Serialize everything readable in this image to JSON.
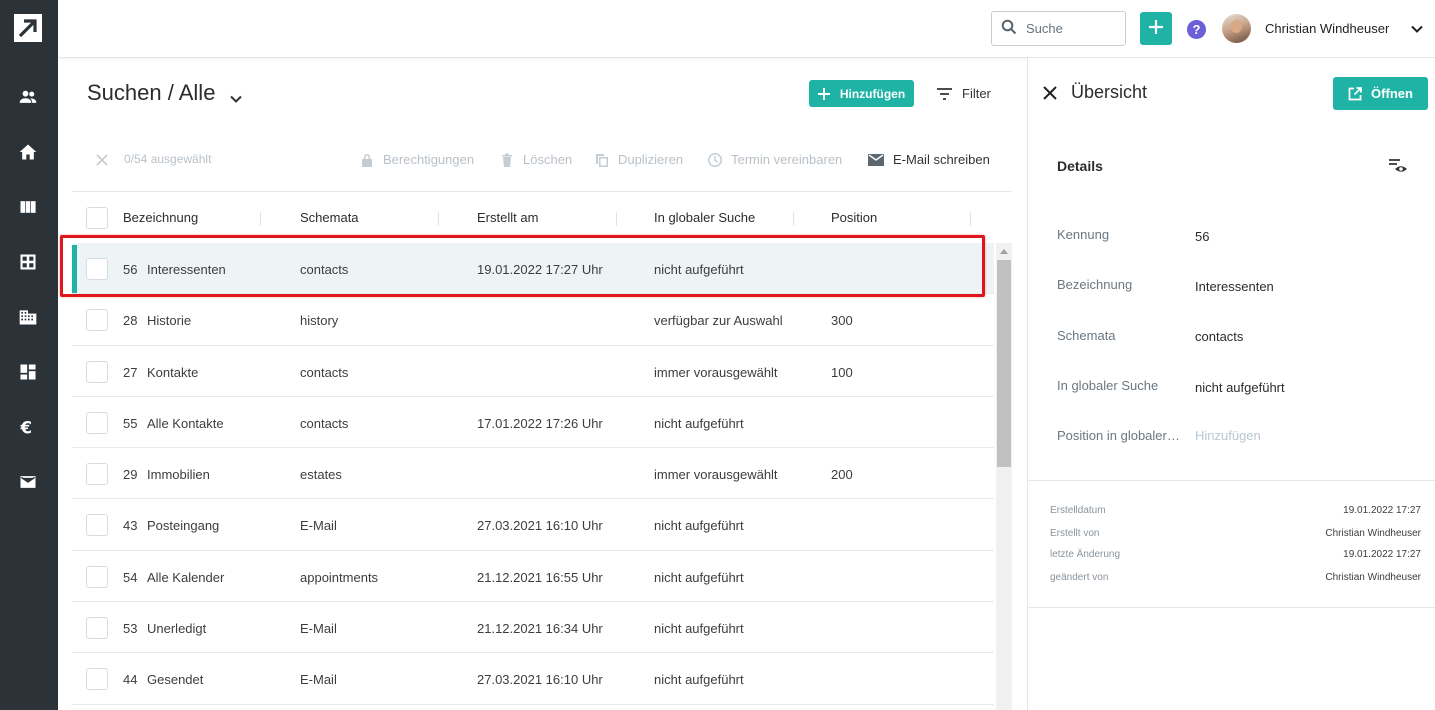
{
  "topbar": {
    "search_placeholder": "Suche",
    "help_label": "?",
    "user_name": "Christian Windheuser"
  },
  "sidebar": {
    "items": [
      "contacts-icon",
      "home-icon",
      "book-icon",
      "grid-icon",
      "building-icon",
      "dashboard-icon",
      "euro-icon",
      "mail-icon"
    ]
  },
  "main": {
    "title": "Suchen / Alle",
    "add_label": "Hinzufügen",
    "filter_label": "Filter",
    "selection_count": "0/54 ausgewählt",
    "actions": {
      "permissions": "Berechtigungen",
      "delete": "Löschen",
      "duplicate": "Duplizieren",
      "appointment": "Termin vereinbaren",
      "email": "E-Mail schreiben"
    },
    "columns": [
      "Bezeichnung",
      "Schemata",
      "Erstellt am",
      "In globaler Suche",
      "Position"
    ],
    "rows": [
      {
        "id": "56",
        "name": "Interessenten",
        "schema": "contacts",
        "created": "19.01.2022 17:27 Uhr",
        "global": "nicht aufgeführt",
        "position": ""
      },
      {
        "id": "28",
        "name": "Historie",
        "schema": "history",
        "created": "",
        "global": "verfügbar zur Auswahl",
        "position": "300"
      },
      {
        "id": "27",
        "name": "Kontakte",
        "schema": "contacts",
        "created": "",
        "global": "immer vorausgewählt",
        "position": "100"
      },
      {
        "id": "55",
        "name": "Alle Kontakte",
        "schema": "contacts",
        "created": "17.01.2022 17:26 Uhr",
        "global": "nicht aufgeführt",
        "position": ""
      },
      {
        "id": "29",
        "name": "Immobilien",
        "schema": "estates",
        "created": "",
        "global": "immer vorausgewählt",
        "position": "200"
      },
      {
        "id": "43",
        "name": "Posteingang",
        "schema": "E-Mail",
        "created": "27.03.2021 16:10 Uhr",
        "global": "nicht aufgeführt",
        "position": ""
      },
      {
        "id": "54",
        "name": "Alle Kalender",
        "schema": "appointments",
        "created": "21.12.2021 16:55 Uhr",
        "global": "nicht aufgeführt",
        "position": ""
      },
      {
        "id": "53",
        "name": "Unerledigt",
        "schema": "E-Mail",
        "created": "21.12.2021 16:34 Uhr",
        "global": "nicht aufgeführt",
        "position": ""
      },
      {
        "id": "44",
        "name": "Gesendet",
        "schema": "E-Mail",
        "created": "27.03.2021 16:10 Uhr",
        "global": "nicht aufgeführt",
        "position": ""
      }
    ]
  },
  "panel": {
    "title": "Übersicht",
    "open_label": "Öffnen",
    "details_title": "Details",
    "fields": [
      {
        "label": "Kennung",
        "value": "56"
      },
      {
        "label": "Bezeichnung",
        "value": "Interessenten"
      },
      {
        "label": "Schemata",
        "value": "contacts"
      },
      {
        "label": "In globaler Suche",
        "value": "nicht aufgeführt"
      },
      {
        "label": "Position in globaler…",
        "value": "Hinzufügen"
      }
    ],
    "meta": [
      {
        "label": "Erstelldatum",
        "value": "19.01.2022 17:27"
      },
      {
        "label": "Erstellt von",
        "value": "Christian Windheuser"
      },
      {
        "label": "letzte Änderung",
        "value": "19.01.2022 17:27"
      },
      {
        "label": "geändert von",
        "value": "Christian Windheuser"
      }
    ]
  },
  "colors": {
    "accent": "#1fb3a5",
    "sidebar": "#2b3238",
    "highlight": "#e0161b",
    "help": "#6c5fd7"
  }
}
